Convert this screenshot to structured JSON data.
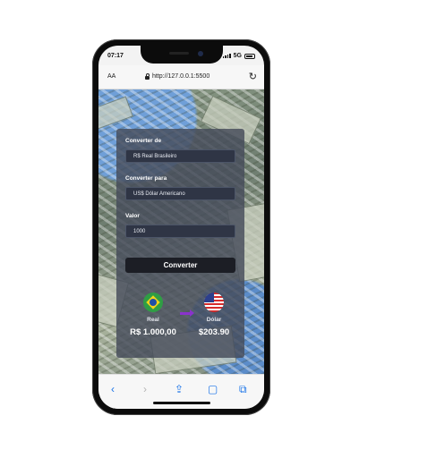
{
  "status_bar": {
    "time": "07:17",
    "network": "5G"
  },
  "browser": {
    "text_size_label": "AA",
    "url": "http://127.0.0.1:5500"
  },
  "form": {
    "from_label": "Converter de",
    "from_value": "R$ Real Brasileiro",
    "to_label": "Converter para",
    "to_value": "US$ Dólar Americano",
    "amount_label": "Valor",
    "amount_value": "1000",
    "convert_button": "Converter"
  },
  "result": {
    "from_currency": {
      "name": "Real",
      "amount": "R$ 1.000,00",
      "flag": "brazil-flag"
    },
    "to_currency": {
      "name": "Dólar",
      "amount": "$203.90",
      "flag": "usa-flag"
    }
  },
  "icons": {
    "back": "chevron-left-icon",
    "forward": "chevron-right-icon",
    "share": "share-icon",
    "bookmarks": "book-icon",
    "tabs": "tabs-icon",
    "reload": "reload-icon",
    "lock": "lock-icon"
  },
  "colors": {
    "card_bg": "#464c5a",
    "button_bg": "#1c1e25",
    "arrow": "#8a33cc",
    "link_blue": "#1a73e8"
  }
}
